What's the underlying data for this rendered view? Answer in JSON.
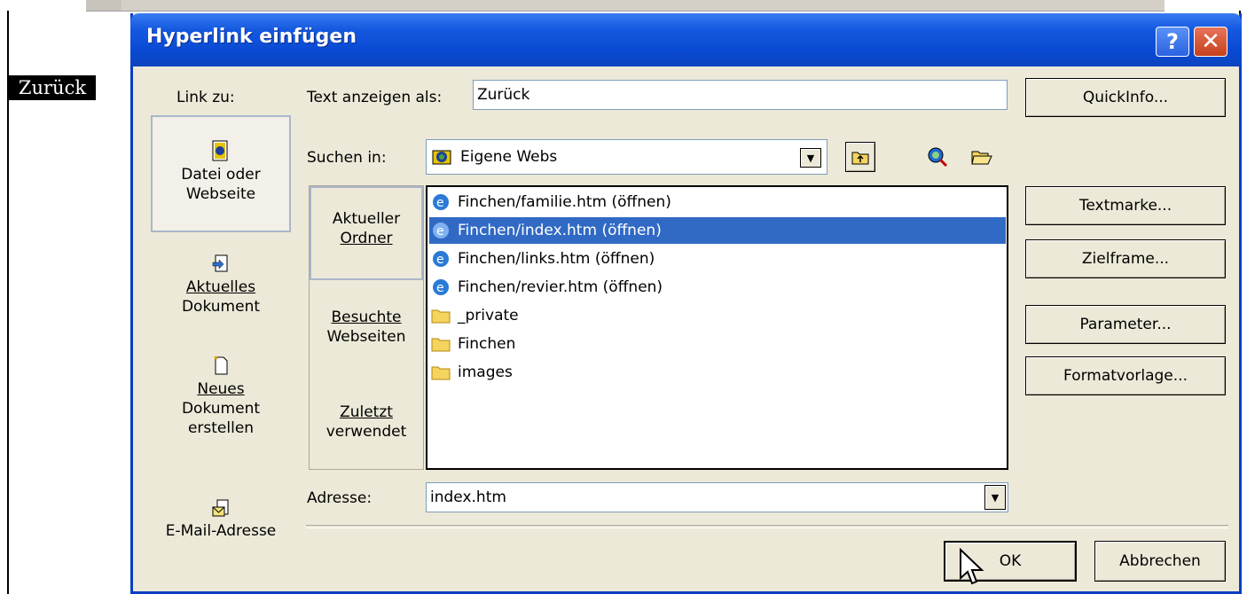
{
  "document": {
    "selected_text": "Zurück"
  },
  "dialog": {
    "title": "Hyperlink einfügen",
    "help_label": "?",
    "close_label": "✕",
    "link_to_label": "Link zu:",
    "places": [
      {
        "label_line1": "Datei oder",
        "label_line2": "Webseite",
        "icon": "globe-file-icon"
      },
      {
        "label_line1": "Aktuelles",
        "label_line2": "Dokument",
        "icon": "document-arrow-icon"
      },
      {
        "label_line1": "Neues",
        "label_line2": "Dokument",
        "label_line3": "erstellen",
        "icon": "new-document-icon"
      },
      {
        "label_line1": "E-Mail-Adresse",
        "icon": "email-icon"
      }
    ],
    "text_display_label": "Text anzeigen als:",
    "text_display_value": "Zurück",
    "quickinfo_button": "QuickInfo...",
    "look_in_label": "Suchen in:",
    "look_in_value": "Eigene Webs",
    "subnav": [
      {
        "line1": "Aktueller",
        "line2": "Ordner"
      },
      {
        "line1": "Besuchte",
        "line2": "Webseiten"
      },
      {
        "line1": "Zuletzt",
        "line2": "verwendet"
      }
    ],
    "files": [
      {
        "name": "Finchen/familie.htm (öffnen)",
        "type": "ie-page-icon"
      },
      {
        "name": "Finchen/index.htm (öffnen)",
        "type": "ie-page-icon"
      },
      {
        "name": "Finchen/links.htm (öffnen)",
        "type": "ie-page-icon"
      },
      {
        "name": "Finchen/revier.htm (öffnen)",
        "type": "ie-page-icon"
      },
      {
        "name": "_private",
        "type": "folder-icon"
      },
      {
        "name": "Finchen",
        "type": "folder-icon"
      },
      {
        "name": "images",
        "type": "folder-icon"
      }
    ],
    "selected_file_index": 1,
    "right_buttons": {
      "bookmark": "Textmarke...",
      "target_frame": "Zielframe...",
      "parameters": "Parameter...",
      "style": "Formatvorlage..."
    },
    "address_label": "Adresse:",
    "address_value": "index.htm",
    "ok_button": "OK",
    "cancel_button": "Abbrechen"
  },
  "colors": {
    "title_blue": "#0a4ad2",
    "selection_blue": "#316ac5",
    "dialog_bg": "#ece9d8"
  }
}
